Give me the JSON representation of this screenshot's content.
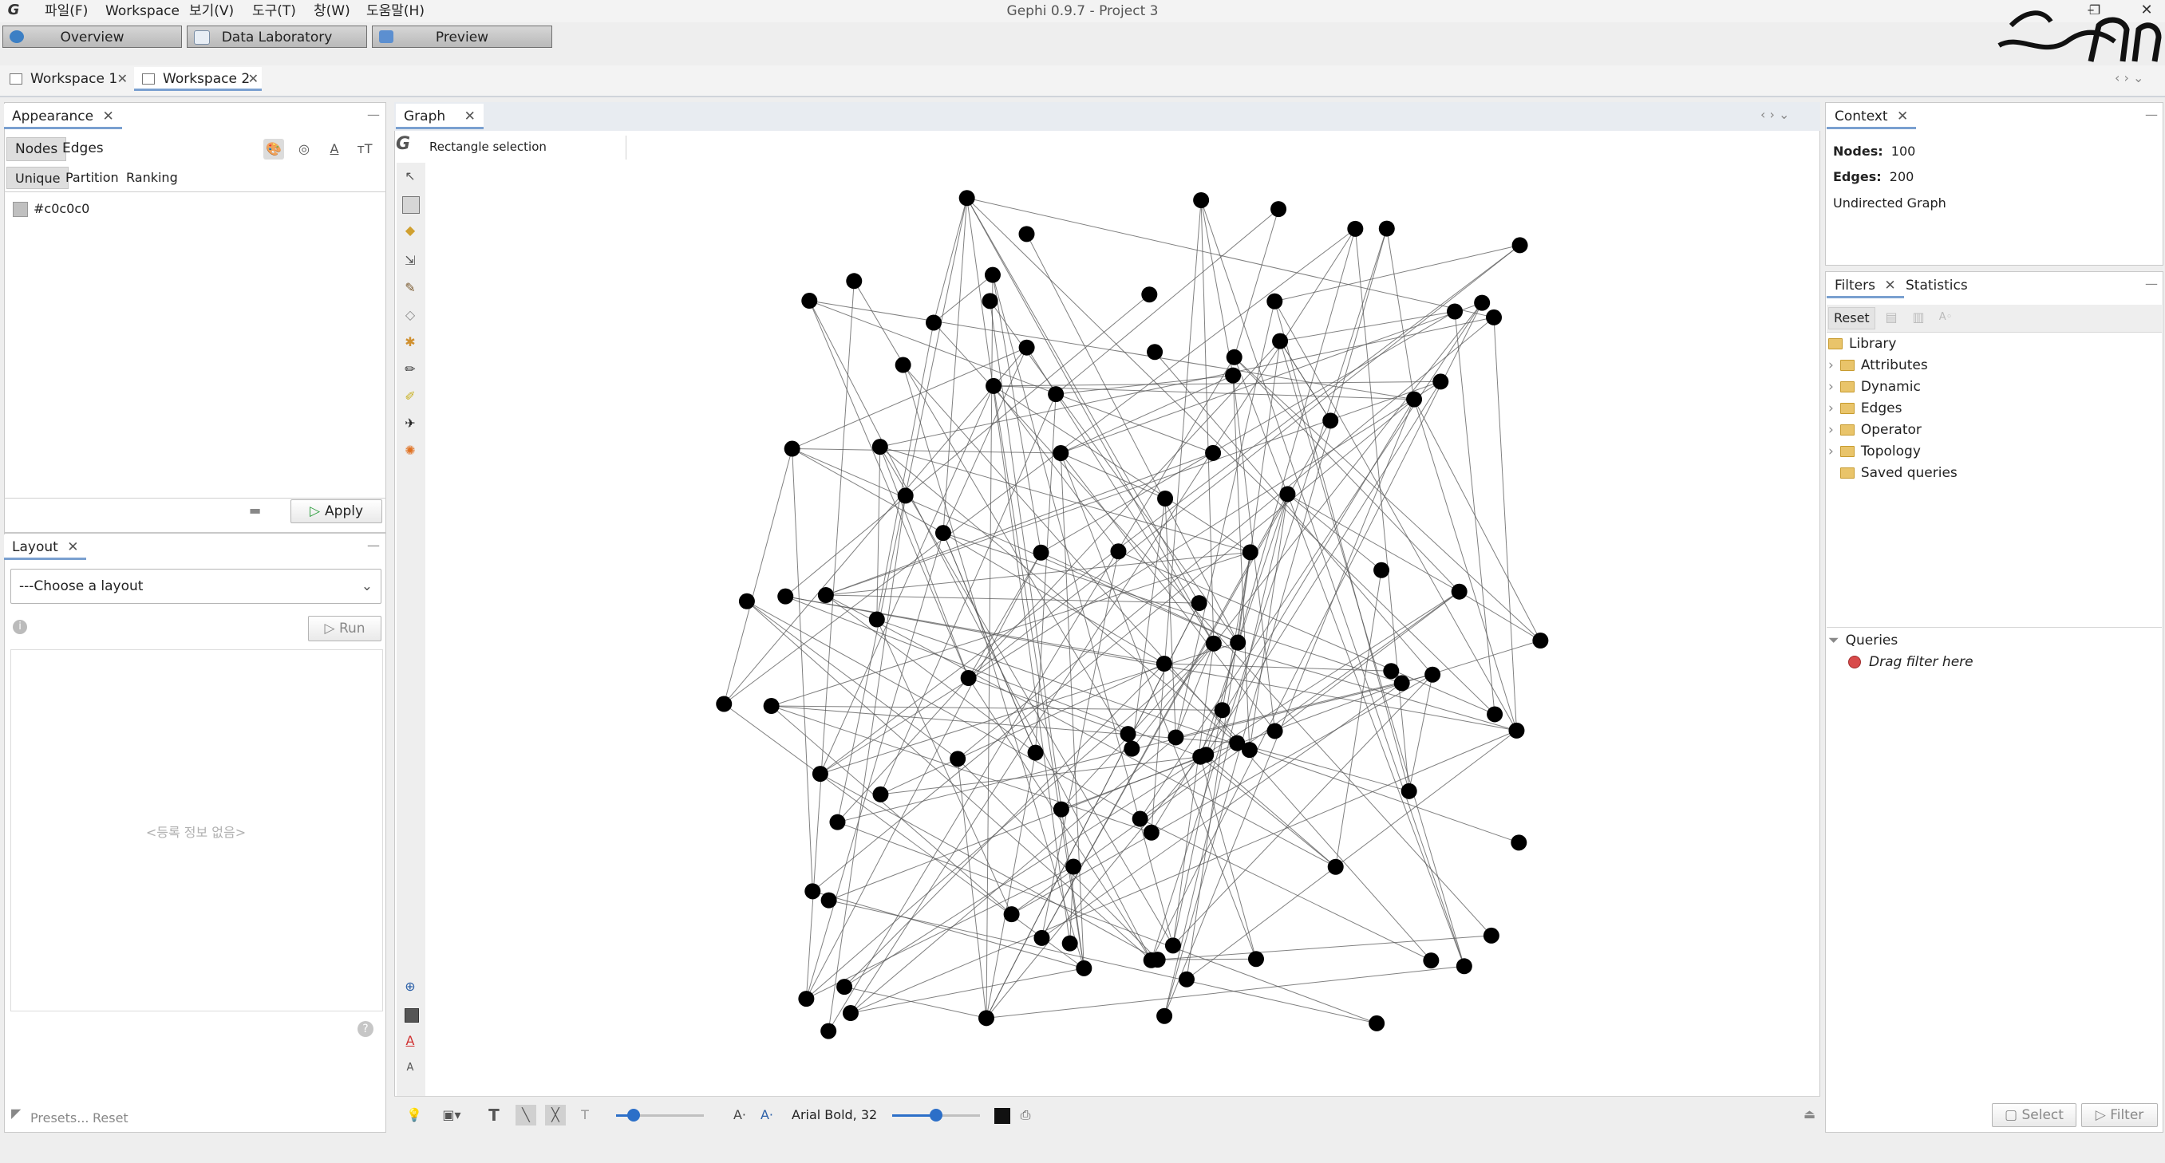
{
  "app": {
    "window_title": "Gephi 0.9.7 - Project 3",
    "logo_icon": "gephi-logo-icon",
    "menu": [
      "파일(F)",
      "Workspace",
      "보기(V)",
      "도구(T)",
      "창(W)",
      "도움말(H)"
    ]
  },
  "modes": {
    "overview": "Overview",
    "data_lab": "Data Laboratory",
    "preview": "Preview"
  },
  "workspaces": [
    "Workspace 1",
    "Workspace 2"
  ],
  "appearance": {
    "title": "Appearance",
    "tabs": [
      "Nodes",
      "Edges"
    ],
    "subtabs": [
      "Unique",
      "Partition",
      "Ranking"
    ],
    "color_value": "#c0c0c0",
    "apply": "Apply"
  },
  "layout": {
    "title": "Layout",
    "select_value": "---Choose a layout",
    "run": "Run",
    "empty_text": "<등록 정보 없음>",
    "presets": "Presets...",
    "reset": "Reset"
  },
  "graph": {
    "title": "Graph",
    "tool_label": "Rectangle selection",
    "node_color": "#000000",
    "edge_color": "#555555"
  },
  "bottom_toolbar": {
    "font_label": "Arial Bold, 32",
    "node_scale_fraction": 0.2,
    "label_scale_fraction": 0.5
  },
  "context": {
    "title": "Context",
    "nodes_label": "Nodes:",
    "nodes_value": "100",
    "edges_label": "Edges:",
    "edges_value": "200",
    "graph_type": "Undirected Graph"
  },
  "filters": {
    "tab_filters": "Filters",
    "tab_statistics": "Statistics",
    "reset": "Reset",
    "library": "Library",
    "items": [
      "Attributes",
      "Dynamic",
      "Edges",
      "Operator",
      "Topology",
      "Saved queries"
    ],
    "queries": "Queries",
    "drag_hint": "Drag filter here",
    "select_btn": "Select",
    "filter_btn": "Filter"
  }
}
